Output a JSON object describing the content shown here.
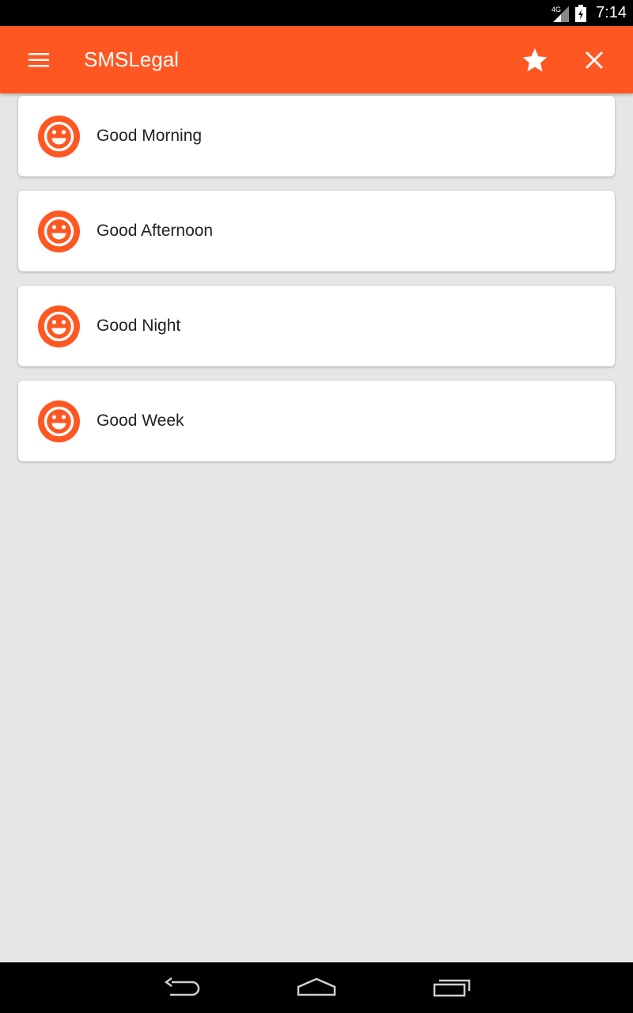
{
  "status_bar": {
    "network": "4G",
    "time": "7:14"
  },
  "app_bar": {
    "title": "SMSLegal",
    "menu_icon": "menu-icon",
    "actions": [
      {
        "icon": "star-icon"
      },
      {
        "icon": "close-icon"
      }
    ]
  },
  "list": {
    "items": [
      {
        "label": "Good Morning",
        "icon": "smiley-icon"
      },
      {
        "label": "Good Afternoon",
        "icon": "smiley-icon"
      },
      {
        "label": "Good Night",
        "icon": "smiley-icon"
      },
      {
        "label": "Good Week",
        "icon": "smiley-icon"
      }
    ]
  },
  "colors": {
    "accent": "#ff5722",
    "background": "#e6e6e6",
    "card": "#ffffff",
    "text": "#222222"
  }
}
